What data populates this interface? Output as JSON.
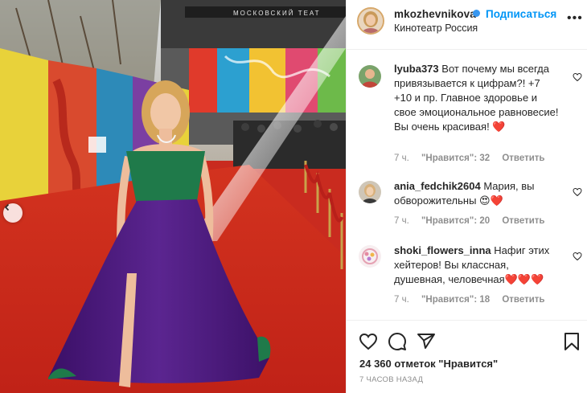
{
  "post": {
    "username": "mkozhevnikova",
    "follow_label": "Подписаться",
    "location": "Кинотеатр Россия",
    "more_label": "•••",
    "photo_sign_text": "МОСКОВСКИЙ    ТЕАТ"
  },
  "comments": [
    {
      "username": "lyuba373",
      "text": "Вот почему мы всегда привязывается к цифрам?! +7 +10 и пр. Главное здоровье и свое эмоциональное равновесие! Вы очень красивая! ❤️",
      "time": "7 ч.",
      "likes": "\"Нравится\": 32",
      "reply": "Ответить"
    },
    {
      "username": "ania_fedchik2604",
      "text": "Мария, вы обворожительны 😍❤️",
      "time": "7 ч.",
      "likes": "\"Нравится\": 20",
      "reply": "Ответить"
    },
    {
      "username": "shoki_flowers_inna",
      "text": "Нафиг этих хейтеров! Вы классная, душевная, человечная❤️❤️❤️",
      "time": "7 ч.",
      "likes": "\"Нравится\": 18",
      "reply": "Ответить"
    }
  ],
  "actions": {
    "likes_text": "24 360 отметок \"Нравится\"",
    "timestamp": "7 ЧАСОВ НАЗАД"
  },
  "colors": {
    "accent": "#0095f6",
    "carpet": "#c92b1f",
    "dress_top": "#1f7a4a",
    "dress_skirt": "#4b1a7a"
  }
}
